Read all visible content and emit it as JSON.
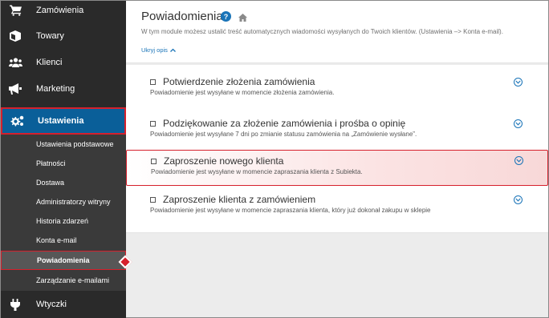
{
  "sidebar": {
    "items": [
      {
        "label": "Zamówienia",
        "icon": "cart-icon"
      },
      {
        "label": "Towary",
        "icon": "box-icon"
      },
      {
        "label": "Klienci",
        "icon": "users-icon"
      },
      {
        "label": "Marketing",
        "icon": "megaphone-icon"
      },
      {
        "label": "Ustawienia",
        "icon": "gears-icon"
      }
    ],
    "sub_items": [
      "Ustawienia podstawowe",
      "Płatności",
      "Dostawa",
      "Administratorzy witryny",
      "Historia zdarzeń",
      "Konta e-mail",
      "Powiadomienia",
      "Zarządzanie e-mailami"
    ],
    "bottom_item": {
      "label": "Wtyczki",
      "icon": "plug-icon"
    }
  },
  "header": {
    "title": "Powiadomienia",
    "help_glyph": "?",
    "description": "W tym module możesz ustalić treść automatycznych wiadomości wysyłanych do Twoich klientów. (Ustawienia –> Konta e-mail).",
    "hide_link": "Ukryj opis"
  },
  "notifications": [
    {
      "title": "Potwierdzenie złożenia zamówienia",
      "subtitle": "Powiadomienie jest wysyłane w momencie złożenia zamówienia."
    },
    {
      "title": "Podziękowanie za złożenie zamówienia i prośba o opinię",
      "subtitle": "Powiadomienie jest wysyłane 7 dni po zmianie statusu zamówienia na „Zamówienie wysłane”."
    },
    {
      "title": "Zaproszenie nowego klienta",
      "subtitle": "Powiadomienie jest wysyłane w momencie zapraszania klienta z Subiekta."
    },
    {
      "title": "Zaproszenie klienta z zamówieniem",
      "subtitle": "Powiadomienie jest wysyłane w momencie zapraszania klienta, który już dokonał zakupu w sklepie"
    }
  ],
  "colors": {
    "sidebar_bg": "#2a2a2a",
    "submenu_bg": "#3a3a3a",
    "active_blue": "#0a5f99",
    "highlight_red": "#d6202c",
    "link_blue": "#1a74b8"
  }
}
